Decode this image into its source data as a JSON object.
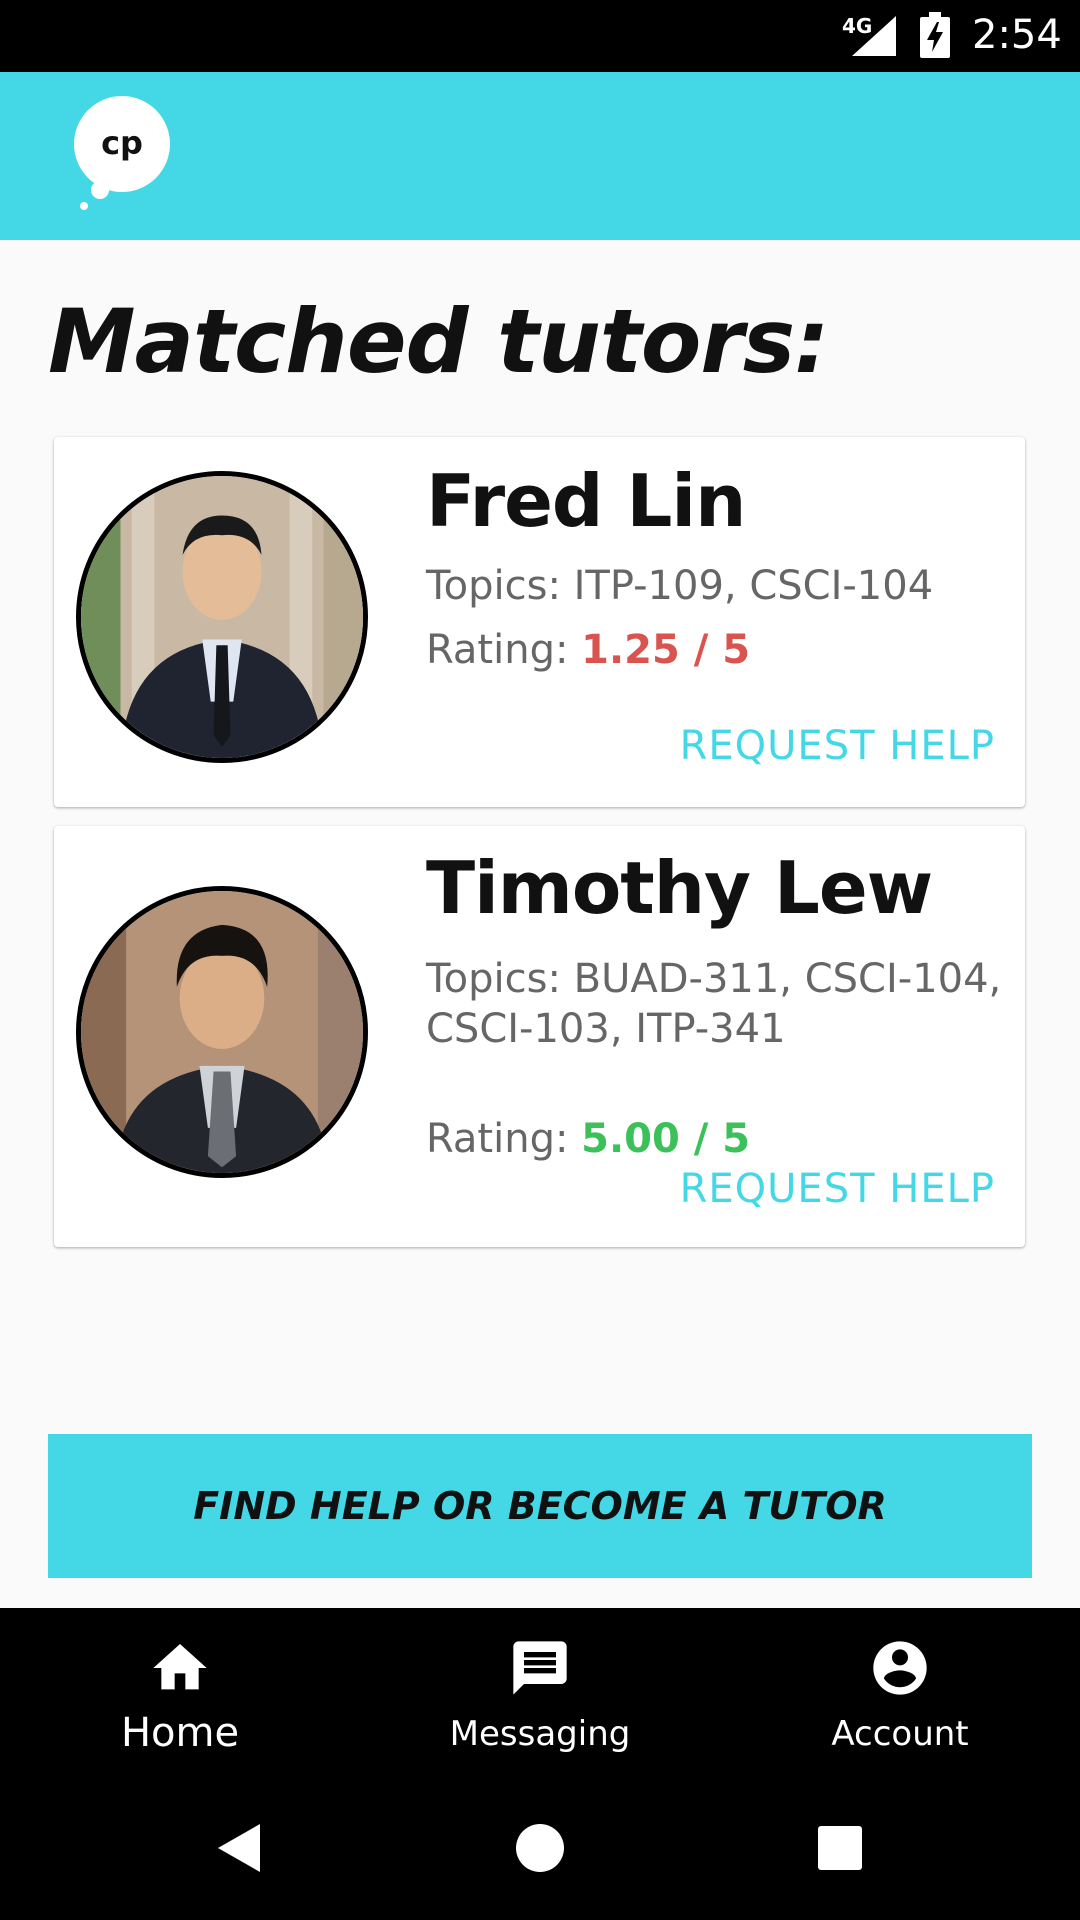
{
  "status_bar": {
    "network": "4G",
    "time": "2:54",
    "icons": [
      "signal-icon",
      "battery-charging-icon"
    ]
  },
  "app_bar": {
    "logo_text": "cp",
    "color": "#44d8e6"
  },
  "page_title": "Matched tutors:",
  "tutors": [
    {
      "name": "Fred Lin",
      "topics": "Topics: ITP-109, CSCI-104",
      "rating_label": "Rating: ",
      "rating_value": "1.25 / 5",
      "rating_color": "#d9534f",
      "action": "REQUEST HELP"
    },
    {
      "name": "Timothy Lew",
      "topics": "Topics: BUAD-311, CSCI-104, CSCI-103, ITP-341",
      "rating_label": "Rating: ",
      "rating_value": "5.00 / 5",
      "rating_color": "#3cc15a",
      "action": "REQUEST HELP"
    }
  ],
  "cta_label": "FIND HELP OR BECOME A TUTOR",
  "bottom_nav": {
    "items": [
      {
        "label": "Home",
        "icon": "home-icon"
      },
      {
        "label": "Messaging",
        "icon": "message-icon"
      },
      {
        "label": "Account",
        "icon": "account-circle-icon"
      }
    ]
  },
  "system_nav": {
    "icons": [
      "back-icon",
      "home-circle-icon",
      "recents-icon"
    ]
  }
}
